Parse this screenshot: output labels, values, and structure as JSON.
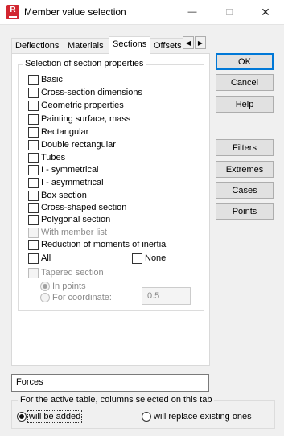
{
  "window": {
    "title": "Member value selection",
    "icon_letter": "R",
    "minimize_glyph": "—",
    "maximize_glyph": "☐",
    "close_glyph": "✕"
  },
  "tabs": [
    {
      "label": "Deflections"
    },
    {
      "label": "Materials"
    },
    {
      "label": "Sections"
    },
    {
      "label": "Offsets"
    }
  ],
  "tab_scroll": {
    "left_glyph": "◀",
    "right_glyph": "▶"
  },
  "group": {
    "title": "Selection of section properties",
    "items": [
      {
        "label": "Basic",
        "checked": false
      },
      {
        "label": "Cross-section dimensions",
        "checked": false
      },
      {
        "label": "Geometric properties",
        "checked": false
      },
      {
        "label": "Painting surface, mass",
        "checked": false
      },
      {
        "label": "Rectangular",
        "checked": false
      },
      {
        "label": "Double rectangular",
        "checked": false
      },
      {
        "label": "Tubes",
        "checked": false
      },
      {
        "label": "I - symmetrical",
        "checked": false
      },
      {
        "label": "I - asymmetrical",
        "checked": false
      },
      {
        "label": "Box section",
        "checked": false
      },
      {
        "label": "Cross-shaped section",
        "checked": false
      },
      {
        "label": "Polygonal section",
        "checked": false
      }
    ],
    "with_member_list": "With member list",
    "reduction": "Reduction of moments of inertia",
    "all": "All",
    "none": "None",
    "tapered": "Tapered section",
    "in_points": "In points",
    "for_coordinate": "For coordinate:",
    "coordinate_value": "0.5"
  },
  "buttons": {
    "ok": "OK",
    "cancel": "Cancel",
    "help": "Help",
    "filters": "Filters",
    "extremes": "Extremes",
    "cases": "Cases",
    "points": "Points"
  },
  "forces_field": {
    "value": "Forces"
  },
  "bottom": {
    "title": "For the active table, columns selected on this tab",
    "will_be_added": "will be added",
    "will_replace": "will replace existing ones"
  },
  "colors": {
    "accent": "#0078d7",
    "app_icon": "#d22630"
  }
}
